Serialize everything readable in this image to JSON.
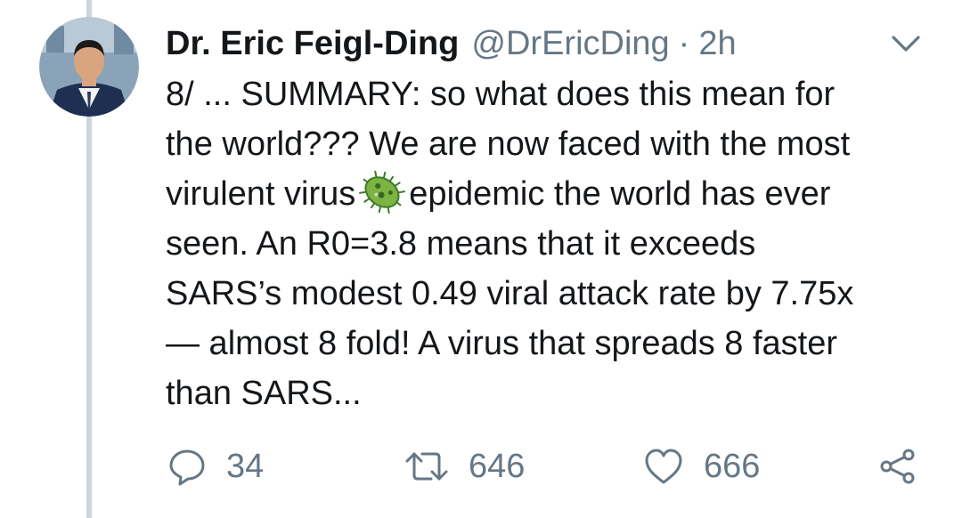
{
  "tweet": {
    "author_name": "Dr. Eric Feigl-Ding",
    "handle": "@DrEricDing",
    "separator": "·",
    "time": "2h",
    "text_lines": [
      "8/ ... SUMMARY: so what does this mean for",
      "the world??? We are now faced with the most",
      "virulent virus",
      "epidemic the world has ever",
      "seen. An R0=3.8 means that it exceeds",
      "SARS’s modest 0.49 viral attack rate by 7.75x",
      "— almost 8 fold! A virus that spreads 8 faster",
      "than SARS..."
    ],
    "emoji": "microbe-emoji"
  },
  "actions": {
    "reply_count": "34",
    "retweet_count": "646",
    "like_count": "666"
  },
  "icons": {
    "reply": "reply-icon",
    "retweet": "retweet-icon",
    "like": "heart-icon",
    "share": "share-icon",
    "more": "chevron-down-icon"
  },
  "colors": {
    "text": "#14171a",
    "secondary": "#657786",
    "thread_line": "#ccd6dd",
    "microbe_green": "#7cb342"
  }
}
